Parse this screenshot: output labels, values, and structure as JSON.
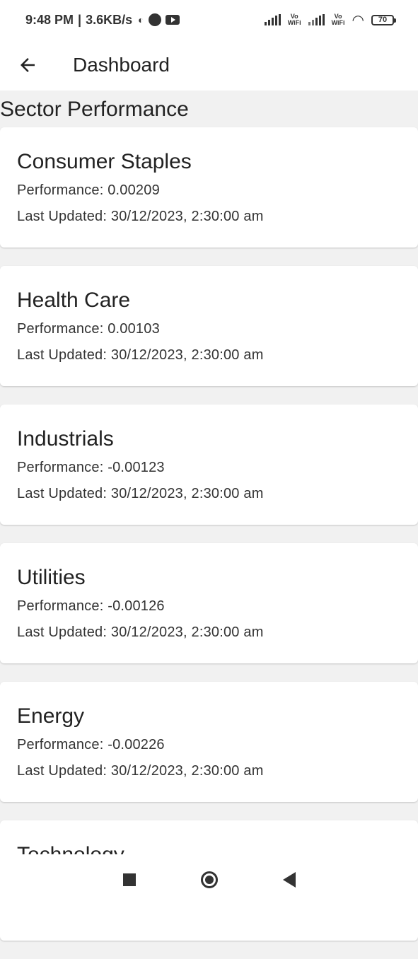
{
  "status_bar": {
    "time": "9:48 PM",
    "speed": "3.6KB/s",
    "battery": "70",
    "vowifi_label_1": "Vo\nWiFi",
    "vowifi_label_2": "Vo\nWiFi"
  },
  "app_bar": {
    "title": "Dashboard",
    "back_icon": "arrow-back-icon"
  },
  "section": {
    "title": "Sector Performance"
  },
  "sectors": [
    {
      "name": "Consumer Staples",
      "performance": "Performance: 0.00209",
      "updated": "Last Updated: 30/12/2023, 2:30:00 am"
    },
    {
      "name": "Health Care",
      "performance": "Performance: 0.00103",
      "updated": "Last Updated: 30/12/2023, 2:30:00 am"
    },
    {
      "name": "Industrials",
      "performance": "Performance: -0.00123",
      "updated": "Last Updated: 30/12/2023, 2:30:00 am"
    },
    {
      "name": "Utilities",
      "performance": "Performance: -0.00126",
      "updated": "Last Updated: 30/12/2023, 2:30:00 am"
    },
    {
      "name": "Energy",
      "performance": "Performance: -0.00226",
      "updated": "Last Updated: 30/12/2023, 2:30:00 am"
    },
    {
      "name": "Technology",
      "performance": "",
      "updated": ""
    }
  ],
  "nav_bar": {
    "icons": [
      "recents-square-icon",
      "home-circle-icon",
      "back-triangle-icon"
    ]
  }
}
